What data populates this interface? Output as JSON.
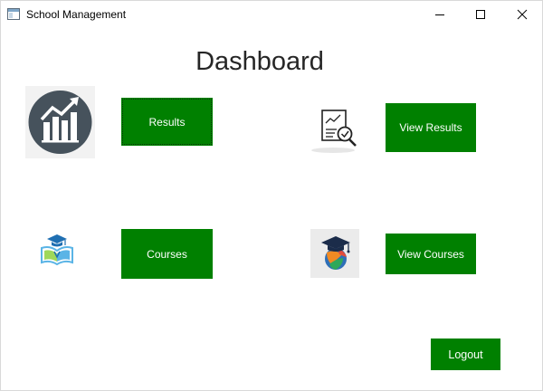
{
  "window": {
    "title": "School Management",
    "controls": {
      "minimize": "minimize",
      "maximize": "maximize",
      "close": "close"
    }
  },
  "page": {
    "heading": "Dashboard"
  },
  "tiles": {
    "results_button": "Results",
    "view_results_button": "View Results",
    "courses_button": "Courses",
    "view_courses_button": "View Courses"
  },
  "icons": {
    "results": "growth-chart-icon",
    "view_results": "report-magnifier-icon",
    "courses": "graduation-book-icon",
    "view_courses": "graduation-cap-globe-icon"
  },
  "footer": {
    "logout_button": "Logout"
  },
  "colors": {
    "button_green": "#008000",
    "button_text": "#ffffff",
    "chart_icon_bg": "#46525c"
  }
}
